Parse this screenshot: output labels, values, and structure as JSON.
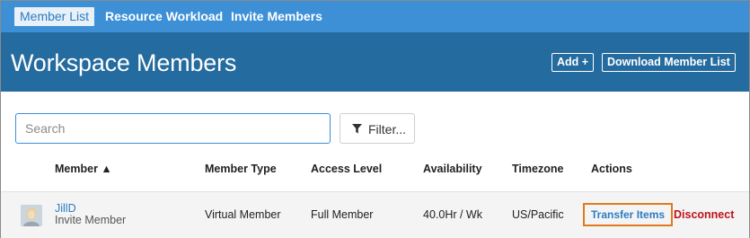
{
  "nav": {
    "tabs": [
      {
        "label": "Member List",
        "active": true
      },
      {
        "label": "Resource Workload",
        "active": false
      },
      {
        "label": "Invite Members",
        "active": false
      }
    ]
  },
  "header": {
    "title": "Workspace Members",
    "add_label": "Add +",
    "download_label": "Download Member List"
  },
  "search": {
    "placeholder": "Search",
    "value": ""
  },
  "filter": {
    "label": "Filter...",
    "icon": "funnel-icon"
  },
  "table": {
    "columns": [
      "Member ▲",
      "Member Type",
      "Access Level",
      "Availability",
      "Timezone",
      "Actions"
    ],
    "rows": [
      {
        "name": "JillD",
        "subtitle": "Invite Member",
        "member_type": "Virtual Member",
        "access_level": "Full Member",
        "availability": "40.0Hr / Wk",
        "timezone": "US/Pacific",
        "actions": [
          "Transfer Items",
          "Disconnect"
        ]
      }
    ]
  },
  "colors": {
    "nav_bar": "#3d8fd6",
    "header_bar": "#246b9f",
    "link_blue": "#2b7cc4",
    "highlight_orange": "#e07a20",
    "disconnect_red": "#c0121b"
  }
}
